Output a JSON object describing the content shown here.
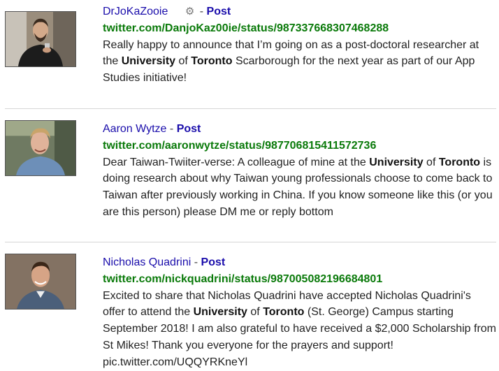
{
  "results": [
    {
      "author": "DrJoKaZooie",
      "has_gear": true,
      "separator": "-",
      "post_label": "Post",
      "url": "twitter.com/DanjoKaz00ie/status/987337668307468288",
      "snippet": [
        {
          "t": "Really happy to announce that I’m going on as a post-doctoral researcher at the "
        },
        {
          "t": "University",
          "b": true
        },
        {
          "t": " of "
        },
        {
          "t": "Toronto",
          "b": true
        },
        {
          "t": " Scarborough for the next year as part of our App Studies initiative!"
        }
      ]
    },
    {
      "author": "Aaron Wytze",
      "has_gear": false,
      "separator": "-",
      "post_label": "Post",
      "url": "twitter.com/aaronwytze/status/987706815411572736",
      "snippet": [
        {
          "t": "Dear Taiwan-Twiiter-verse: A colleague of mine at the "
        },
        {
          "t": "University",
          "b": true
        },
        {
          "t": " of "
        },
        {
          "t": "Toronto",
          "b": true
        },
        {
          "t": " is doing research about why Taiwan young professionals choose to come back to Taiwan after previously working in China. If you know someone like this (or you are this person) please DM me or reply bottom"
        }
      ]
    },
    {
      "author": "Nicholas Quadrini",
      "has_gear": false,
      "separator": "-",
      "post_label": "Post",
      "url": "twitter.com/nickquadrini/status/987005082196684801",
      "snippet": [
        {
          "t": "Excited to share that Nicholas Quadrini have accepted Nicholas Quadrini's offer to attend the "
        },
        {
          "t": "University",
          "b": true
        },
        {
          "t": " of "
        },
        {
          "t": "Toronto",
          "b": true
        },
        {
          "t": " (St. George) Campus starting September 2018! I am also grateful to have received a $2,000 Scholarship from St Mikes! Thank you everyone for the prayers and support! pic.twitter.com/UQQYRKneYl"
        }
      ]
    }
  ],
  "icons": {
    "gear": "gear-icon"
  },
  "colors": {
    "author_link": "#1a0dab",
    "url": "#0a7a0a",
    "divider": "#d6d6d6"
  }
}
